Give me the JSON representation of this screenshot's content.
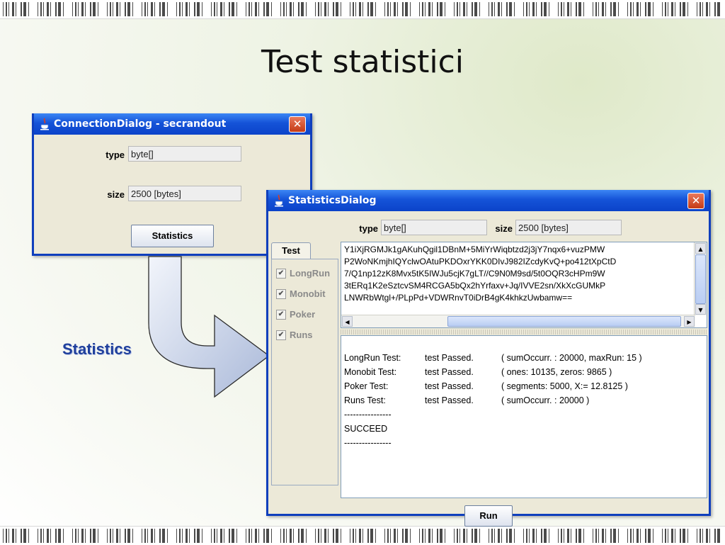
{
  "slide": {
    "title": "Test statistici",
    "caption": "Statistics"
  },
  "connection_dialog": {
    "title": "ConnectionDialog - secrandout",
    "close_glyph": "✕",
    "type_label": "type",
    "type_value": "byte[]",
    "size_label": "size",
    "size_value": "2500 [bytes]",
    "statistics_button": "Statistics"
  },
  "statistics_dialog": {
    "title": "StatisticsDialog",
    "close_glyph": "✕",
    "type_label": "type",
    "type_value": "byte[]",
    "size_label": "size",
    "size_value": "2500 [bytes]",
    "tab_label": "Test",
    "checks": [
      {
        "label": "LongRun",
        "checked": true
      },
      {
        "label": "Monobit",
        "checked": true
      },
      {
        "label": "Poker",
        "checked": true
      },
      {
        "label": "Runs",
        "checked": true
      }
    ],
    "data_lines": [
      "Y1iXjRGMJk1gAKuhQgil1DBnM+5MiYrWiqbtzd2j3jY7nqx6+vuzPMW",
      "P2WoNKmjhIQYclwOAtuPKDOxrYKK0DIvJ982IZcdyKvQ+po412tXpCtD",
      "7/Q1np12zK8Mvx5tK5IWJu5cjK7gLT//C9N0M9sd/5t0OQR3cHPm9W",
      "3tERq1K2eSztcvSM4RCGA5bQx2hYrfaxv+Jq/IVVE2sn/XkXcGUMkP",
      "LNWRbWtgl+/PLpPd+VDWRnvT0iDrB4gK4khkzUwbamw=="
    ],
    "results": [
      {
        "name": "LongRun Test:",
        "status": "test Passed.",
        "detail": "( sumOccurr. : 20000, maxRun: 15 )"
      },
      {
        "name": "Monobit Test:",
        "status": "test Passed.",
        "detail": "( ones: 10135, zeros: 9865 )"
      },
      {
        "name": "Poker Test:",
        "status": "test Passed.",
        "detail": "( segments: 5000, X:= 12.8125 )"
      },
      {
        "name": "Runs Test:",
        "status": "test Passed.",
        "detail": "( sumOccurr. : 20000 )"
      }
    ],
    "separator_1": "----------------",
    "summary": "SUCCEED",
    "separator_2": "----------------",
    "run_button": "Run"
  }
}
